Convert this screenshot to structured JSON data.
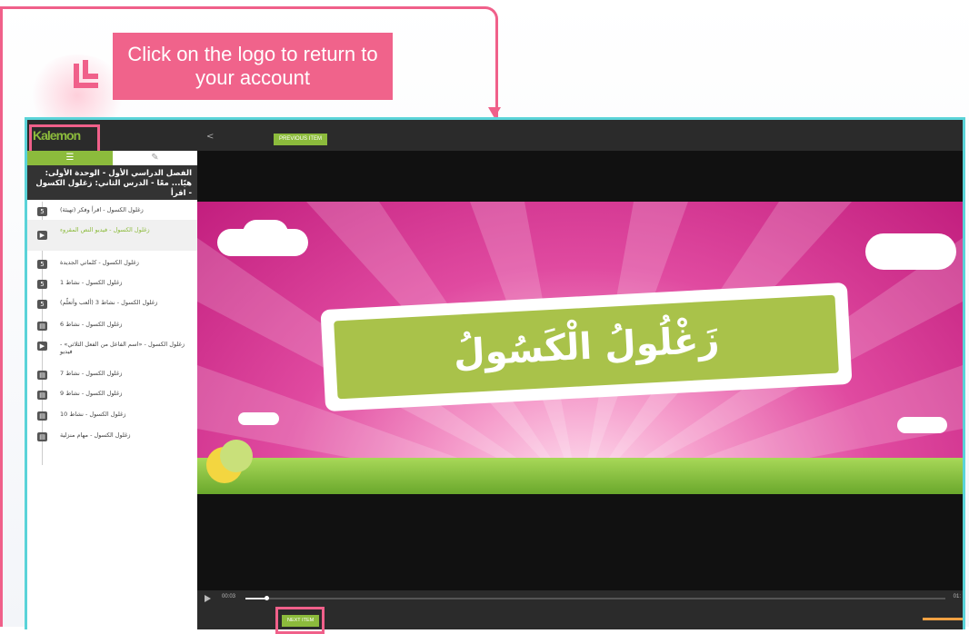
{
  "tutorial": {
    "tooltip": "Click on the logo to return to your account"
  },
  "topbar": {
    "logo": "Kalemon",
    "back_chevron": "<",
    "previous_label": "PREVIOUS ITEM"
  },
  "sidebar": {
    "tabs": [
      {
        "icon": "list-icon"
      },
      {
        "icon": "edit-icon"
      }
    ],
    "course_title": "الفصل الدراسي الأول - الوحدة الأولى: هيّا... معًا - الدرس الثاني: زغلول الكسول - اقرأ",
    "lessons": [
      {
        "type": "html",
        "label": "زغلول الكسول - اقرأ وفكر (تهيئة)"
      },
      {
        "type": "video",
        "label": "زغلول الكسول - فيديو النص المقروء",
        "active": true
      },
      {
        "type": "html",
        "label": "زغلول الكسول - كلماتي الجديدة"
      },
      {
        "type": "html",
        "label": "زغلول الكسول - نشاط 1"
      },
      {
        "type": "html",
        "label": "زغلول الكسول - نشاط 3 (ألعب وأتعلّم)"
      },
      {
        "type": "doc",
        "label": "زغلول الكسول - نشاط 6"
      },
      {
        "type": "video",
        "label": "زغلول الكسول - «اسم الفاعل من الفعل الثلاثي» - فيديو"
      },
      {
        "type": "doc",
        "label": "زغلول الكسول - نشاط 7"
      },
      {
        "type": "doc",
        "label": "زغلول الكسول - نشاط 9"
      },
      {
        "type": "doc",
        "label": "زغلول الكسول - نشاط 10"
      },
      {
        "type": "doc",
        "label": "زغلول الكسول - مهام منزلية"
      }
    ]
  },
  "video": {
    "title": "زَغْلُولُ الْكَسُولُ",
    "current_time": "00:03",
    "end_time": "01:",
    "progress": 0.03
  },
  "footer": {
    "next_label": "NEXT ITEM"
  },
  "colors": {
    "accent": "#8cbb3c",
    "highlight": "#f0608a",
    "frame": "#5ad3d8"
  }
}
